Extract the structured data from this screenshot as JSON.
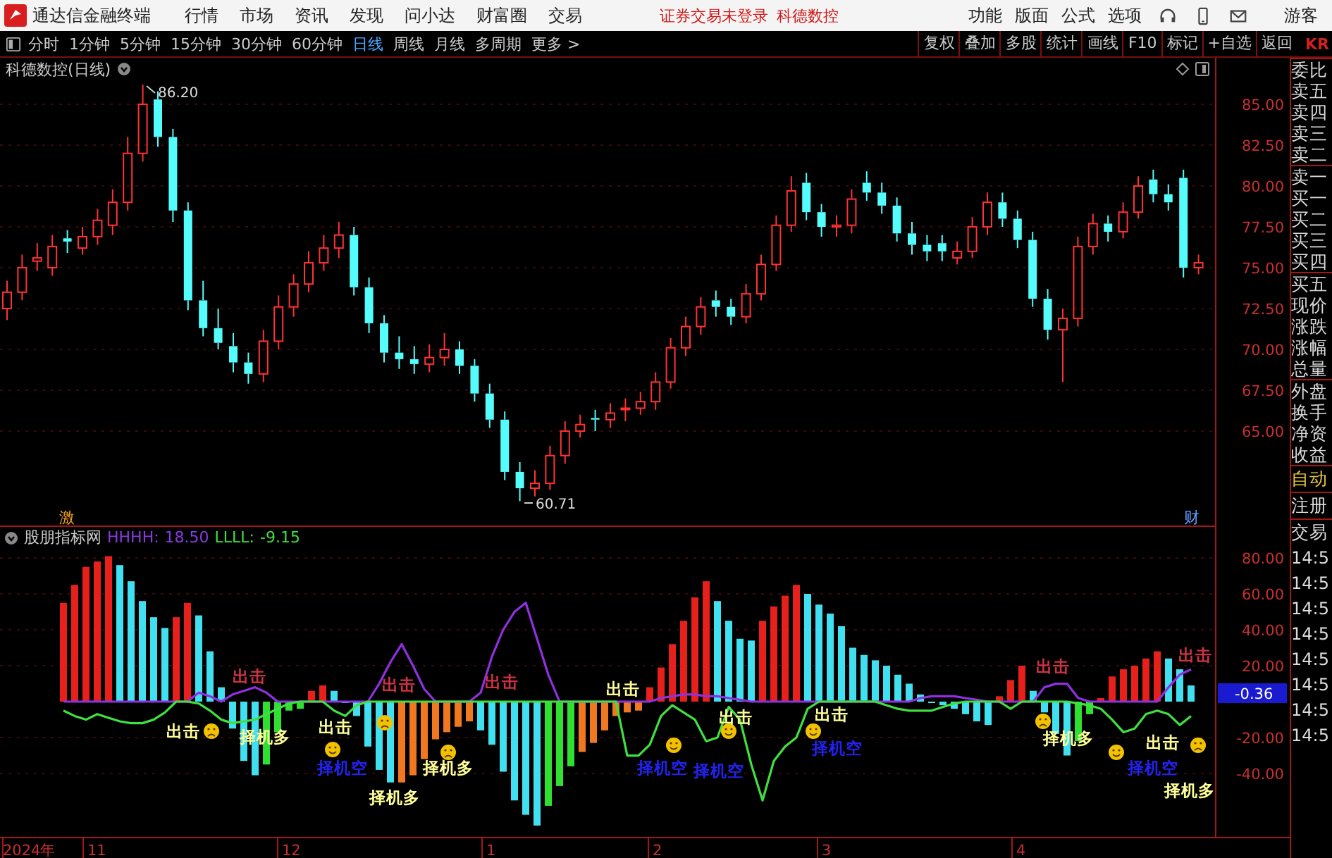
{
  "menu_bar": {
    "app_title": "通达信金融终端",
    "menus": [
      "行情",
      "市场",
      "资讯",
      "发现",
      "问小达",
      "财富圈",
      "交易"
    ],
    "notices": [
      "证券交易未登录",
      "科德数控"
    ],
    "right_menus": [
      "功能",
      "版面",
      "公式",
      "选项"
    ],
    "user": "游客"
  },
  "toolbar": {
    "periods": [
      {
        "label": "分时",
        "selected": false
      },
      {
        "label": "1分钟",
        "selected": false
      },
      {
        "label": "5分钟",
        "selected": false
      },
      {
        "label": "15分钟",
        "selected": false
      },
      {
        "label": "30分钟",
        "selected": false
      },
      {
        "label": "60分钟",
        "selected": false
      },
      {
        "label": "日线",
        "selected": true
      },
      {
        "label": "周线",
        "selected": false
      },
      {
        "label": "月线",
        "selected": false
      },
      {
        "label": "多周期",
        "selected": false
      },
      {
        "label": "更多 >",
        "selected": false
      }
    ],
    "tools": [
      "复权",
      "叠加",
      "多股",
      "统计",
      "画线",
      "F10",
      "标记",
      "+自选",
      "返回"
    ],
    "cut_label": "KR"
  },
  "price_chart": {
    "title": "科德数控(日线)",
    "high_label": "86.20",
    "low_label": "60.71",
    "markers": [
      "激",
      "财"
    ],
    "chart_data": {
      "type": "candlestick",
      "ylim": [
        59.22,
        86.47
      ],
      "grid": true,
      "yticks": [
        {
          "value": 85,
          "label": "85.00"
        },
        {
          "value": 82.5,
          "label": "82.50"
        },
        {
          "value": 80,
          "label": "80.00"
        },
        {
          "value": 77.5,
          "label": "77.50"
        },
        {
          "value": 75,
          "label": "75.00"
        },
        {
          "value": 72.5,
          "label": "72.50"
        },
        {
          "value": 70,
          "label": "70.00"
        },
        {
          "value": 67.5,
          "label": "67.50"
        },
        {
          "value": 65,
          "label": "65.00"
        }
      ],
      "ohlc": [
        [
          72.5,
          74.2,
          71.8,
          73.5
        ],
        [
          73.5,
          75.8,
          73.0,
          75.0
        ],
        [
          75.4,
          76.5,
          74.8,
          75.6
        ],
        [
          75.0,
          77.0,
          74.5,
          76.3
        ],
        [
          76.8,
          77.3,
          75.9,
          76.6
        ],
        [
          76.2,
          77.5,
          75.8,
          76.9
        ],
        [
          76.9,
          78.6,
          76.4,
          77.9
        ],
        [
          77.6,
          79.8,
          77.0,
          79.0
        ],
        [
          79.0,
          83.0,
          78.5,
          82.0
        ],
        [
          82.0,
          86.2,
          81.5,
          85.0
        ],
        [
          85.3,
          85.8,
          82.4,
          83.0
        ],
        [
          83.0,
          83.5,
          77.8,
          78.5
        ],
        [
          78.5,
          79.0,
          72.4,
          73.0
        ],
        [
          73.0,
          74.2,
          70.8,
          71.3
        ],
        [
          71.3,
          72.5,
          70.0,
          70.4
        ],
        [
          70.2,
          71.0,
          68.6,
          69.2
        ],
        [
          69.2,
          69.8,
          67.9,
          68.5
        ],
        [
          68.5,
          71.2,
          68.0,
          70.5
        ],
        [
          70.5,
          73.3,
          70.0,
          72.6
        ],
        [
          72.6,
          74.6,
          72.0,
          74.0
        ],
        [
          74.0,
          76.0,
          73.5,
          75.3
        ],
        [
          75.3,
          77.0,
          74.8,
          76.2
        ],
        [
          76.2,
          77.8,
          75.6,
          77.0
        ],
        [
          77.0,
          77.5,
          73.3,
          73.8
        ],
        [
          73.8,
          74.4,
          71.0,
          71.6
        ],
        [
          71.6,
          72.1,
          69.2,
          69.8
        ],
        [
          69.8,
          70.8,
          68.8,
          69.4
        ],
        [
          69.4,
          70.2,
          68.5,
          69.1
        ],
        [
          69.1,
          70.3,
          68.6,
          69.5
        ],
        [
          69.5,
          71.0,
          69.0,
          70.0
        ],
        [
          70.0,
          70.5,
          68.5,
          69.0
        ],
        [
          69.0,
          69.4,
          66.8,
          67.3
        ],
        [
          67.3,
          67.9,
          65.2,
          65.7
        ],
        [
          65.7,
          66.2,
          62.0,
          62.5
        ],
        [
          62.5,
          63.1,
          60.71,
          61.5
        ],
        [
          61.5,
          62.6,
          61.0,
          61.8
        ],
        [
          61.8,
          64.1,
          61.4,
          63.5
        ],
        [
          63.5,
          65.6,
          63.0,
          65.0
        ],
        [
          65.0,
          66.0,
          64.6,
          65.4
        ],
        [
          65.8,
          66.3,
          65.0,
          65.7
        ],
        [
          65.7,
          66.7,
          65.2,
          66.1
        ],
        [
          66.4,
          67.0,
          65.6,
          66.4
        ],
        [
          66.4,
          67.4,
          66.0,
          66.8
        ],
        [
          66.8,
          68.6,
          66.3,
          68.0
        ],
        [
          68.0,
          70.7,
          67.6,
          70.1
        ],
        [
          70.1,
          72.0,
          69.6,
          71.4
        ],
        [
          71.4,
          73.2,
          70.9,
          72.6
        ],
        [
          73.0,
          73.6,
          72.0,
          72.6
        ],
        [
          72.6,
          73.1,
          71.5,
          72.0
        ],
        [
          72.0,
          74.0,
          71.6,
          73.4
        ],
        [
          73.4,
          75.8,
          73.0,
          75.2
        ],
        [
          75.2,
          78.2,
          74.8,
          77.6
        ],
        [
          77.6,
          80.6,
          77.2,
          79.7
        ],
        [
          80.2,
          80.8,
          77.9,
          78.4
        ],
        [
          78.4,
          78.9,
          76.9,
          77.5
        ],
        [
          77.5,
          78.2,
          76.9,
          77.6
        ],
        [
          77.6,
          79.8,
          77.1,
          79.2
        ],
        [
          80.2,
          80.9,
          79.1,
          79.6
        ],
        [
          79.6,
          80.2,
          78.3,
          78.8
        ],
        [
          78.8,
          79.3,
          76.6,
          77.1
        ],
        [
          77.1,
          77.8,
          75.8,
          76.4
        ],
        [
          76.4,
          77.0,
          75.4,
          76.0
        ],
        [
          76.5,
          77.0,
          75.4,
          76.0
        ],
        [
          75.6,
          76.6,
          75.2,
          76.0
        ],
        [
          76.0,
          78.1,
          75.6,
          77.5
        ],
        [
          77.5,
          79.6,
          77.0,
          79.0
        ],
        [
          79.0,
          79.6,
          77.5,
          78.0
        ],
        [
          78.0,
          78.5,
          76.2,
          76.7
        ],
        [
          76.7,
          77.2,
          72.6,
          73.1
        ],
        [
          73.1,
          73.7,
          70.6,
          71.2
        ],
        [
          71.2,
          72.5,
          68.0,
          71.9
        ],
        [
          71.9,
          76.9,
          71.4,
          76.3
        ],
        [
          76.3,
          78.3,
          75.8,
          77.7
        ],
        [
          77.7,
          78.2,
          76.6,
          77.2
        ],
        [
          77.2,
          79.0,
          76.8,
          78.4
        ],
        [
          78.4,
          80.6,
          78.0,
          80.0
        ],
        [
          80.4,
          81.0,
          79.0,
          79.5
        ],
        [
          79.5,
          80.1,
          78.5,
          79.0
        ],
        [
          80.5,
          81.0,
          74.4,
          75.0
        ],
        [
          75.0,
          75.8,
          74.6,
          75.3
        ]
      ]
    }
  },
  "indicator": {
    "name": "股朋指标网",
    "readouts": [
      "18.50",
      "-9.15"
    ],
    "current_value": "-0.36",
    "chart_data": {
      "type": "bar",
      "ylim": [
        -75.29,
        85.49
      ],
      "grid": true,
      "yticks": [
        {
          "value": 80,
          "label": "80.00"
        },
        {
          "value": 60,
          "label": "60.00"
        },
        {
          "value": 40,
          "label": "40.00"
        },
        {
          "value": 20,
          "label": "20.00"
        },
        {
          "value": -20,
          "label": "-20.00"
        },
        {
          "value": -40,
          "label": "-40.00"
        }
      ],
      "series": [
        {
          "colors": [
            "#e8201c",
            "#e8201c",
            "#e8201c",
            "#e8201c",
            "#e8201c",
            "#40e0f0",
            "#40e0f0",
            "#40e0f0",
            "#40e0f0",
            "#40e0f0",
            "#e8201c",
            "#e8201c",
            "#40e0f0",
            "#40e0f0",
            "#40e0f0",
            "#40e0f0",
            "#40e0f0",
            "#40e0f0",
            "#30e030",
            "#30e030",
            "#30e030",
            "#30e030",
            "#e8201c",
            "#e8201c",
            "#40e0f0",
            "#40e0f0",
            "#40e0f0",
            "#40e0f0",
            "#40e0f0",
            "#40e0f0",
            "#f07820",
            "#f07820",
            "#f07820",
            "#f07820",
            "#f07820",
            "#f07820",
            "#f07820",
            "#40e0f0",
            "#40e0f0",
            "#40e0f0",
            "#40e0f0",
            "#40e0f0",
            "#40e0f0",
            "#30e030",
            "#30e030",
            "#30e030",
            "#f07820",
            "#f07820",
            "#f07820",
            "#f07820",
            "#f07820",
            "#f07820",
            "#e8201c",
            "#e8201c",
            "#e8201c",
            "#e8201c",
            "#e8201c",
            "#e8201c",
            "#40e0f0",
            "#40e0f0",
            "#40e0f0",
            "#40e0f0",
            "#e8201c",
            "#e8201c",
            "#e8201c",
            "#e8201c",
            "#40e0f0",
            "#40e0f0",
            "#40e0f0",
            "#40e0f0",
            "#40e0f0",
            "#40e0f0",
            "#40e0f0",
            "#40e0f0",
            "#40e0f0",
            "#40e0f0",
            "#40e0f0",
            "#40e0f0",
            "#40e0f0",
            "#40e0f0",
            "#40e0f0",
            "#40e0f0",
            "#40e0f0",
            "#e8201c",
            "#e8201c",
            "#e8201c",
            "#40e0f0",
            "#40e0f0",
            "#40e0f0",
            "#40e0f0",
            "#30e030",
            "#30e030",
            "#e8201c",
            "#e8201c",
            "#e8201c",
            "#e8201c",
            "#e8201c",
            "#e8201c",
            "#40e0f0",
            "#40e0f0",
            "#40e0f0"
          ],
          "values": [
            55,
            65,
            75,
            78,
            81,
            76,
            67,
            56,
            47,
            41,
            47,
            55,
            48,
            28,
            8,
            -15,
            -33,
            -41,
            -35,
            -17,
            -5,
            -4,
            6,
            9,
            6,
            0,
            -8,
            -25,
            -38,
            -45,
            -45,
            -41,
            -32,
            -21,
            -17,
            -14,
            -11,
            -16,
            -24,
            -39,
            -55,
            -63,
            -69,
            -58,
            -47,
            -36,
            -28,
            -23,
            -16,
            -8,
            -6,
            -5,
            8,
            19,
            32,
            45,
            58,
            67,
            56,
            45,
            35,
            34,
            45,
            53,
            59,
            65,
            60,
            54,
            49,
            42,
            30,
            26,
            23,
            20,
            15,
            10,
            4,
            0,
            -2,
            -4,
            -7,
            -11,
            -13,
            3,
            12,
            20,
            6,
            -6,
            -18,
            -30,
            -22,
            -7,
            2,
            14,
            18,
            20,
            24,
            28,
            24,
            18,
            9
          ]
        },
        {
          "name": "HHHH:",
          "type": "line",
          "color": "#9030e0",
          "values": [
            0,
            0,
            0,
            0,
            0,
            0,
            0,
            0,
            0,
            0,
            0,
            0,
            5,
            3,
            0,
            4,
            6,
            8,
            5,
            0,
            0,
            0,
            0,
            0,
            0,
            0,
            0,
            0,
            10,
            22,
            32,
            20,
            7,
            0,
            0,
            0,
            0,
            5,
            25,
            40,
            50,
            55,
            35,
            15,
            0,
            0,
            0,
            0,
            0,
            0,
            0,
            0,
            0,
            2,
            3,
            4,
            4,
            3,
            3,
            2,
            1,
            0,
            0,
            0,
            0,
            0,
            0,
            0,
            0,
            0,
            0,
            0,
            0,
            0,
            0,
            0,
            2,
            3,
            3,
            3,
            2,
            1,
            0,
            0,
            0,
            0,
            0,
            8,
            10,
            10,
            2,
            0,
            0,
            0,
            0,
            0,
            0,
            0,
            8,
            15,
            18
          ]
        },
        {
          "name": "LLLL:",
          "type": "line",
          "color": "#40e040",
          "values": [
            -5,
            -8,
            -10,
            -7,
            -9,
            -11,
            -12,
            -12,
            -10,
            -6,
            0,
            0,
            -1,
            -5,
            -10,
            -12,
            -11,
            -10,
            -7,
            -4,
            -1,
            0,
            0,
            0,
            -5,
            -8,
            -2,
            0,
            0,
            0,
            0,
            0,
            0,
            0,
            0,
            0,
            0,
            0,
            0,
            0,
            0,
            0,
            0,
            0,
            0,
            0,
            0,
            0,
            0,
            0,
            -30,
            -30,
            -24,
            -8,
            -2,
            -6,
            -10,
            -22,
            -20,
            -3,
            -10,
            -35,
            -55,
            -33,
            -25,
            -20,
            -4,
            0,
            0,
            0,
            0,
            0,
            0,
            -2,
            -4,
            -5,
            -5,
            -5,
            -3,
            -1,
            0,
            0,
            0,
            0,
            -4,
            0,
            0,
            0,
            0,
            0,
            -1,
            -2,
            -4,
            -10,
            -17,
            -15,
            -7,
            -5,
            -7,
            -13,
            -8
          ]
        }
      ]
    },
    "annotations": [
      {
        "text": "出击",
        "color": "#ffff99"
      },
      {
        "text": "出击",
        "color": "#cc3344"
      },
      {
        "text": "出击",
        "color": "#ffff99"
      },
      {
        "text": "出击",
        "color": "#cc3344"
      },
      {
        "text": "出击",
        "color": "#cc3344"
      },
      {
        "text": "择机多",
        "color": "#ffff99"
      },
      {
        "text": "择机空",
        "color": "#2222ee"
      },
      {
        "text": "择机多",
        "color": "#ffff99"
      },
      {
        "text": "择机多",
        "color": "#ffff99"
      },
      {
        "text": "出击",
        "color": "#ffff99"
      },
      {
        "text": "择机空",
        "color": "#2222ee"
      },
      {
        "text": "出击",
        "color": "#ffff99"
      },
      {
        "text": "择机空",
        "color": "#2222ee"
      },
      {
        "text": "出击",
        "color": "#ffff99"
      },
      {
        "text": "择机空",
        "color": "#2222ee"
      },
      {
        "text": "出击",
        "color": "#cc3344"
      },
      {
        "text": "择机多",
        "color": "#ffff99"
      },
      {
        "text": "出击",
        "color": "#ffff99"
      },
      {
        "text": "出击",
        "color": "#cc3344"
      },
      {
        "text": "择机空",
        "color": "#2222ee"
      },
      {
        "text": "择机多",
        "color": "#ffff99"
      }
    ]
  },
  "date_axis": [
    "2024年",
    "11",
    "12",
    "1",
    "2",
    "3",
    "4"
  ],
  "side_panel": {
    "fields": [
      "委比",
      "卖五",
      "卖四",
      "卖三",
      "卖二",
      "卖一",
      "买一",
      "买二",
      "买三",
      "买四",
      "买五",
      "现价",
      "涨跌",
      "涨幅",
      "总量",
      "外盘",
      "换手",
      "净资",
      "收益"
    ],
    "buttons": [
      {
        "label": "自动",
        "selected": true
      },
      {
        "label": "注册",
        "selected": false
      },
      {
        "label": "交易",
        "selected": false
      }
    ],
    "times": [
      "14:5",
      "14:5",
      "14:5",
      "14:5",
      "14:5",
      "14:5",
      "14:5",
      "14:5"
    ]
  }
}
